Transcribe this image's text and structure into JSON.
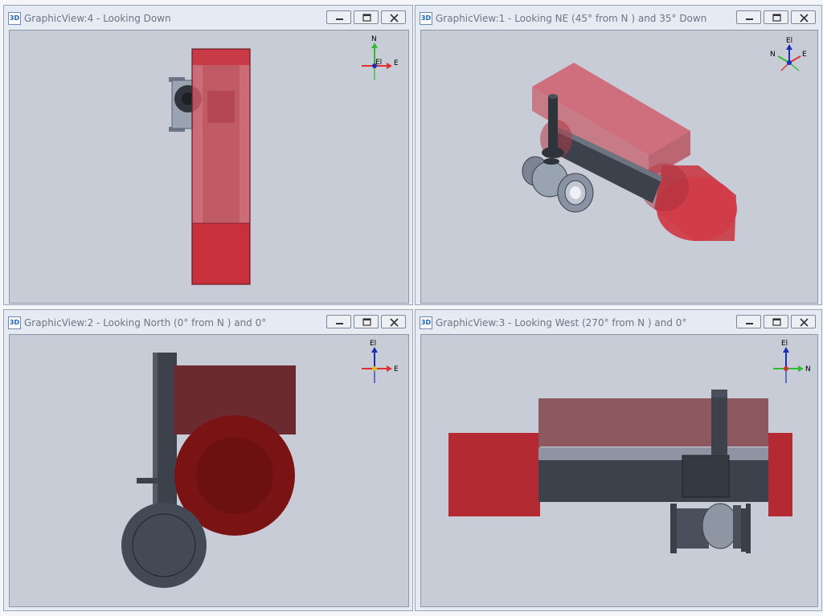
{
  "panes": [
    {
      "id": "view4",
      "title": "GraphicView:4 - Looking Down",
      "icon_text": "3D",
      "axes": [
        "N",
        "E",
        "El"
      ]
    },
    {
      "id": "view1",
      "title": "GraphicView:1 - Looking NE (45° from N ) and 35° Down",
      "icon_text": "3D",
      "axes": [
        "El",
        "N",
        "E"
      ]
    },
    {
      "id": "view2",
      "title": "GraphicView:2 - Looking North (0° from N ) and 0°",
      "icon_text": "3D",
      "axes": [
        "El",
        "E"
      ]
    },
    {
      "id": "view3",
      "title": "GraphicView:3 - Looking West (270° from N ) and 0°",
      "icon_text": "3D",
      "axes": [
        "El",
        "N"
      ]
    }
  ],
  "window_buttons": {
    "minimize": "minimize-icon",
    "restore": "restore-icon",
    "close": "close-icon"
  },
  "colors": {
    "pane_bg": "#e6ebf3",
    "viewport_bg": "#c8ccd6",
    "volume_red": "#c0303a",
    "pipe_dark": "#3c414c",
    "axis_north": "#2ebd2e",
    "axis_east": "#e03030",
    "axis_up": "#1a2eb8"
  }
}
